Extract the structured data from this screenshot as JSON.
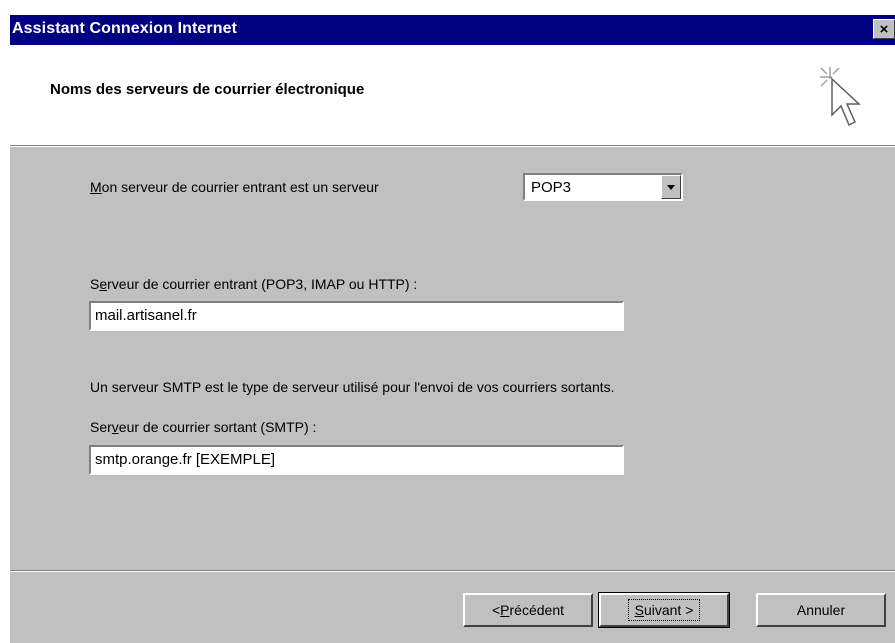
{
  "window": {
    "title": "Assistant Connexion Internet",
    "close_glyph": "×"
  },
  "header": {
    "title": "Noms des serveurs de courrier électronique",
    "icon": "wizard-sparkle-cursor-icon"
  },
  "server_type": {
    "label_key": "M",
    "label_rest": "on serveur de courrier entrant est un serveur",
    "selected": "POP3"
  },
  "incoming": {
    "label_pre": "S",
    "label_key": "e",
    "label_rest": "rveur de courrier entrant (POP3, IMAP ou HTTP) :",
    "value": "mail.artisanel.fr"
  },
  "smtp_info": "Un serveur SMTP est le type de serveur utilisé pour l'envoi de vos courriers sortants.",
  "outgoing": {
    "label_pre": "Ser",
    "label_key": "v",
    "label_rest": "eur de courrier sortant (SMTP) :",
    "value": "smtp.orange.fr [EXEMPLE]"
  },
  "buttons": {
    "back_prefix": "< ",
    "back_key": "P",
    "back_rest": "récédent",
    "next_key": "S",
    "next_rest": "uivant >",
    "cancel": "Annuler"
  },
  "colors": {
    "titlebar": "#000080",
    "dialog_face": "#c0c0c0",
    "header_bg": "#ffffff"
  }
}
